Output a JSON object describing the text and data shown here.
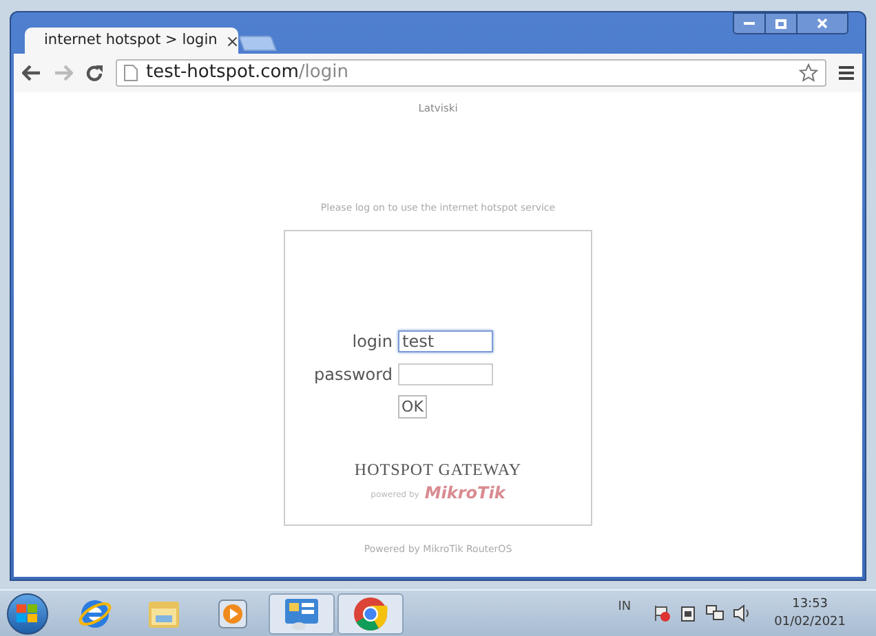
{
  "browser": {
    "tab": {
      "title": "internet hotspot > login",
      "close": "×"
    },
    "address": {
      "host": "test-hotspot.com",
      "path": "/login"
    }
  },
  "page": {
    "language_link": "Latviski",
    "prompt": "Please log on to use the internet hotspot service",
    "form": {
      "fields": [
        {
          "label": "login",
          "value": "test",
          "focused": true
        },
        {
          "label": "password",
          "focused": false
        }
      ],
      "submit": "OK"
    },
    "brand": {
      "title": "HOTSPOT GATEWAY",
      "powered_by": "powered by",
      "logo": "MikroTik"
    },
    "footer": "Powered by MikroTik RouterOS"
  },
  "taskbar": {
    "apps": [
      {
        "kind": "ie",
        "active": false
      },
      {
        "kind": "explorer",
        "active": false
      },
      {
        "kind": "media",
        "active": false
      },
      {
        "kind": "control",
        "active": true
      },
      {
        "kind": "chrome",
        "active": true
      }
    ],
    "language": "IN",
    "time": "13:53",
    "date": "01/02/2021"
  }
}
